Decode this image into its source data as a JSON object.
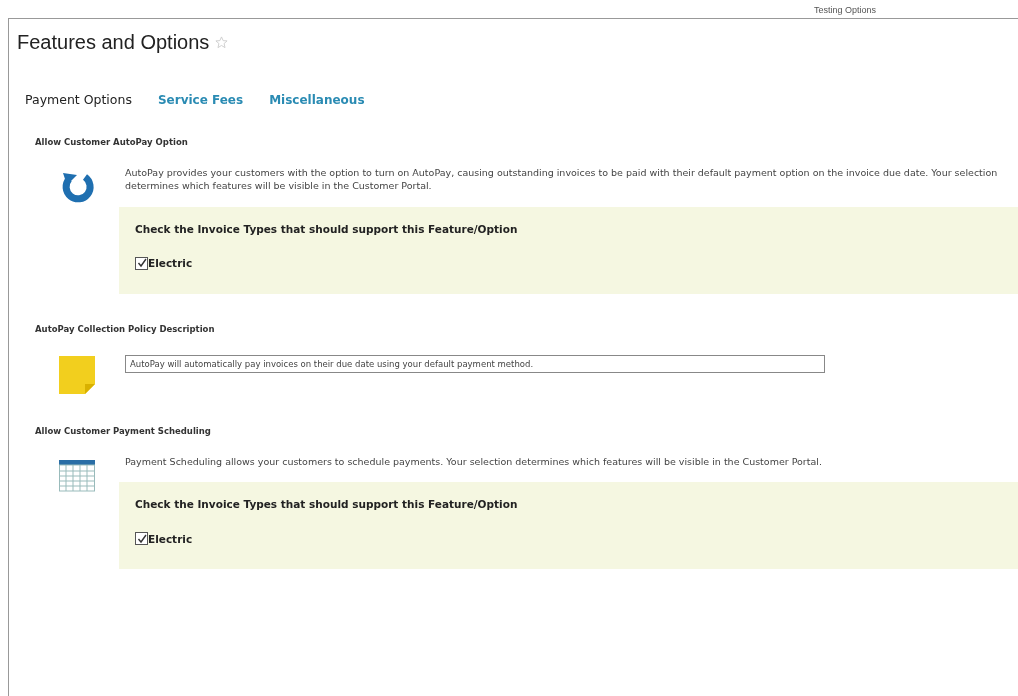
{
  "header": {
    "title": "Features and Options",
    "favorite": false,
    "context_label": "Testing Options"
  },
  "tabs": [
    {
      "label": "Payment Options",
      "selected": true
    },
    {
      "label": "Service Fees",
      "selected": false
    },
    {
      "label": "Miscellaneous",
      "selected": false
    }
  ],
  "sections": [
    {
      "kind": "invoice_types",
      "title": "Allow Customer AutoPay Option",
      "description": "AutoPay provides your customers with the option to turn on AutoPay, causing outstanding invoices to be paid with their default payment option on the invoice due date. Your selection determines which features will be visible in the Customer Portal.",
      "panel_title": "Check the Invoice Types that should support this Feature/Option",
      "options": [
        {
          "label": "Electric",
          "checked": true
        }
      ]
    },
    {
      "kind": "text",
      "title": "AutoPay Collection Policy Description",
      "value": "AutoPay will automatically pay invoices on their due date using your default payment method."
    },
    {
      "kind": "invoice_types",
      "title": "Allow Customer Payment Scheduling",
      "description": "Payment Scheduling allows your customers to schedule payments. Your selection determines which features will be visible in the Customer Portal.",
      "panel_title": "Check the Invoice Types that should support this Feature/Option",
      "options": [
        {
          "label": "Electric",
          "checked": true
        }
      ]
    }
  ]
}
